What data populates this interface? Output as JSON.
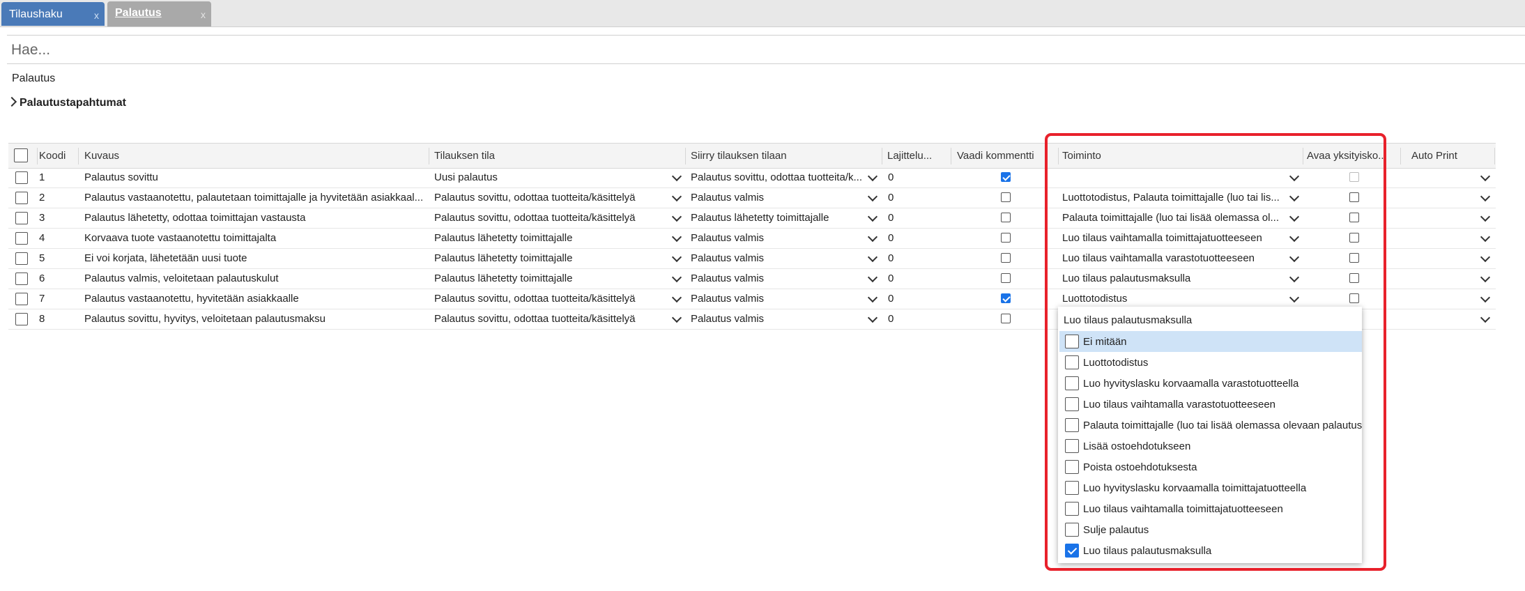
{
  "tabs": [
    {
      "label": "Tilaushaku",
      "close": "x"
    },
    {
      "label": "Palautus",
      "close": "x"
    }
  ],
  "search": {
    "placeholder": "Hae..."
  },
  "breadcrumb": "Palautus",
  "section": {
    "label": "Palautustapahtumat"
  },
  "columns": {
    "code": "Koodi",
    "desc": "Kuvaus",
    "state": "Tilauksen tila",
    "move": "Siirry tilauksen tilaan",
    "sort": "Lajittelu...",
    "comment": "Vaadi kommentti",
    "action": "Toiminto",
    "detail": "Avaa yksityisko...",
    "print": "Auto Print"
  },
  "rows": [
    {
      "code": "1",
      "desc": "Palautus sovittu",
      "state": "Uusi palautus",
      "move": "Palautus sovittu, odottaa tuotteita/k...",
      "sort": "0",
      "comment": true,
      "action": "",
      "detail": false,
      "detail_disabled": true
    },
    {
      "code": "2",
      "desc": "Palautus vastaanotettu, palautetaan toimittajalle ja hyvitetään asiakkaal...",
      "state": "Palautus sovittu, odottaa tuotteita/käsittelyä",
      "move": "Palautus valmis",
      "sort": "0",
      "comment": false,
      "action": "Luottotodistus, Palauta toimittajalle (luo tai lis...",
      "detail": false
    },
    {
      "code": "3",
      "desc": "Palautus lähetetty, odottaa toimittajan vastausta",
      "state": "Palautus sovittu, odottaa tuotteita/käsittelyä",
      "move": "Palautus lähetetty toimittajalle",
      "sort": "0",
      "comment": false,
      "action": "Palauta toimittajalle (luo tai lisää olemassa ol...",
      "detail": false
    },
    {
      "code": "4",
      "desc": "Korvaava tuote vastaanotettu toimittajalta",
      "state": "Palautus lähetetty toimittajalle",
      "move": "Palautus valmis",
      "sort": "0",
      "comment": false,
      "action": "Luo tilaus vaihtamalla toimittajatuotteeseen",
      "detail": false
    },
    {
      "code": "5",
      "desc": "Ei voi korjata, lähetetään uusi tuote",
      "state": "Palautus lähetetty toimittajalle",
      "move": "Palautus valmis",
      "sort": "0",
      "comment": false,
      "action": "Luo tilaus vaihtamalla varastotuotteeseen",
      "detail": false
    },
    {
      "code": "6",
      "desc": "Palautus valmis, veloitetaan palautuskulut",
      "state": "Palautus lähetetty toimittajalle",
      "move": "Palautus valmis",
      "sort": "0",
      "comment": false,
      "action": "Luo tilaus palautusmaksulla",
      "detail": false
    },
    {
      "code": "7",
      "desc": "Palautus vastaanotettu, hyvitetään asiakkaalle",
      "state": "Palautus sovittu, odottaa tuotteita/käsittelyä",
      "move": "Palautus valmis",
      "sort": "0",
      "comment": true,
      "action": "Luottotodistus",
      "detail": false
    },
    {
      "code": "8",
      "desc": "Palautus sovittu, hyvitys, veloitetaan palautusmaksu",
      "state": "Palautus sovittu, odottaa tuotteita/käsittelyä",
      "move": "Palautus valmis",
      "sort": "0",
      "comment": false,
      "action": "",
      "detail": false
    }
  ],
  "dropdown": {
    "current": "Luo tilaus palautusmaksulla",
    "options": [
      {
        "label": "Ei mitään",
        "checked": false,
        "highlighted": true
      },
      {
        "label": "Luottotodistus",
        "checked": false
      },
      {
        "label": "Luo hyvityslasku korvaamalla varastotuotteella",
        "checked": false
      },
      {
        "label": "Luo tilaus vaihtamalla varastotuotteeseen",
        "checked": false
      },
      {
        "label": "Palauta toimittajalle (luo tai lisää olemassa olevaan palautust",
        "checked": false
      },
      {
        "label": "Lisää ostoehdotukseen",
        "checked": false
      },
      {
        "label": "Poista ostoehdotuksesta",
        "checked": false
      },
      {
        "label": "Luo hyvityslasku korvaamalla toimittajatuotteella",
        "checked": false
      },
      {
        "label": "Luo tilaus vaihtamalla toimittajatuotteeseen",
        "checked": false
      },
      {
        "label": "Sulje palautus",
        "checked": false
      },
      {
        "label": "Luo tilaus palautusmaksulla",
        "checked": true
      }
    ]
  },
  "colors": {
    "highlight_box": "#e8212b",
    "active_tab": "#4a7ab8",
    "checkbox_on": "#1a73e8"
  },
  "icons": [
    "chevron-right-icon",
    "chevron-down-icon",
    "close-icon",
    "checkbox-icon"
  ]
}
